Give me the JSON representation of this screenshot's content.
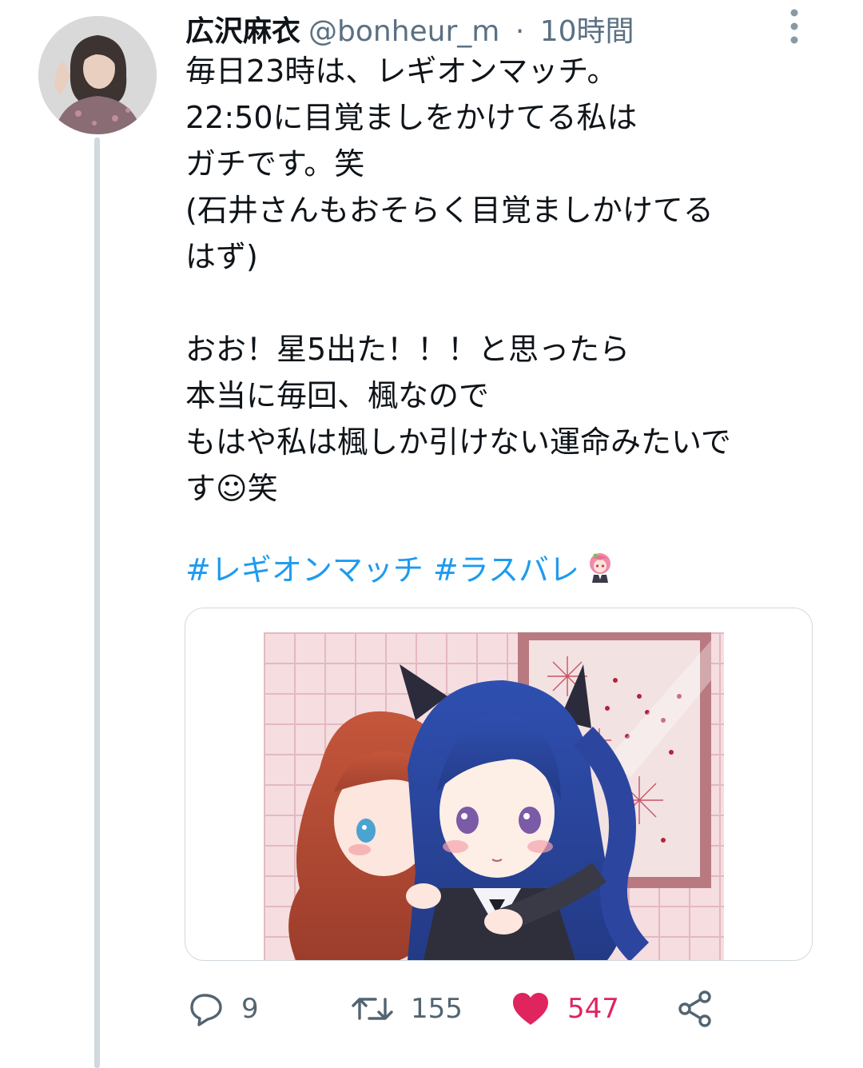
{
  "tweet": {
    "author_name": "広沢麻衣",
    "handle": "@bonheur_m",
    "separator": "·",
    "time": "10時間",
    "text": "毎日23時は、レギオンマッチ。\n22:50に目覚ましをかけてる私は\nガチです。笑\n(石井さんもおそらく目覚ましかけてる\nはず)\n\nおお！星5出た！！！と思ったら\n本当に毎回、楓なので\nもはや私は楓しか引けない運命みたいで\nす☺笑",
    "hashtags": "#レギオンマッチ #ラスバレ"
  },
  "actions": {
    "reply_count": "9",
    "retweet_count": "155",
    "like_count": "547"
  },
  "icons": {
    "more": "more-vertical-icon",
    "reply": "reply-icon",
    "retweet": "retweet-icon",
    "like": "heart-filled-icon",
    "share": "share-icon",
    "hashflag": "character-hashflag-icon"
  },
  "colors": {
    "hashtag": "#1d9bf0",
    "like": "#e0245e",
    "secondary_text": "#5b7083",
    "thread_line": "#cfd9de"
  }
}
